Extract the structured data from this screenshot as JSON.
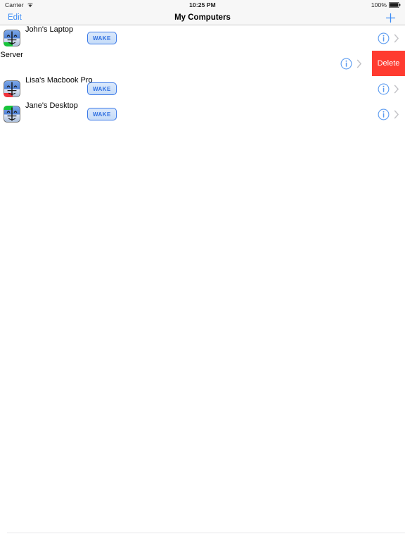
{
  "status_bar": {
    "carrier": "Carrier",
    "wifi_icon": "wifi-icon",
    "time": "10:25 PM",
    "battery_percent": "100%",
    "battery_icon": "battery-full-icon"
  },
  "nav_bar": {
    "edit_label": "Edit",
    "title": "My Computers",
    "add_icon": "plus-icon"
  },
  "colors": {
    "accent_blue": "#007AFF",
    "nav_blue": "#3c8cf5",
    "delete_red": "#ff3b30",
    "wake_border": "#3c7ae8",
    "wake_text": "#2f6fe0",
    "separator": "#e4e4e6",
    "bar_background": "#f7f7f7"
  },
  "list": {
    "wake_label": "WAKE",
    "delete_label": "Delete",
    "info_icon": "info-circle-icon",
    "chevron_icon": "chevron-right-icon",
    "computer_icon": "finder-face-icon",
    "rows": [
      {
        "name": "John's Laptop",
        "icon_accent": "#18c43c",
        "icon_accent_corner": "bottom-left",
        "has_wake": true,
        "swiped": false
      },
      {
        "name": "S Server",
        "icon_accent": "",
        "icon_accent_corner": "",
        "has_wake": false,
        "swiped": true
      },
      {
        "name": "Lisa's Macbook Pro",
        "icon_accent": "#f0333c",
        "icon_accent_corner": "bottom-left",
        "has_wake": true,
        "swiped": false
      },
      {
        "name": "Jane's Desktop",
        "icon_accent": "#18c43c",
        "icon_accent_corner": "top-left",
        "has_wake": true,
        "swiped": false
      }
    ],
    "empty_row_count": 16
  }
}
